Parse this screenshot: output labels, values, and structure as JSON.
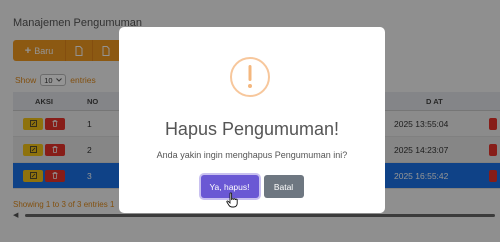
{
  "page": {
    "title": "Manajemen Pengumuman",
    "toolbar": {
      "new_label": "Baru"
    },
    "show": {
      "prefix": "Show",
      "value": "10",
      "suffix": "entries"
    },
    "table": {
      "columns": [
        "AKSI",
        "NO",
        "D AT"
      ],
      "rows": [
        {
          "no": "1",
          "updated": "2025 13:55:04"
        },
        {
          "no": "2",
          "updated": "2025 14:23:07"
        },
        {
          "no": "3",
          "updated": "2025 16:55:42"
        }
      ]
    },
    "footer": "Showing 1 to 3 of 3 entries 1"
  },
  "dialog": {
    "icon": "exclamation",
    "title": "Hapus Pengumuman!",
    "message": "Anda yakin ingin menghapus Pengumuman ini?",
    "confirm_label": "Ya, hapus!",
    "cancel_label": "Batal"
  },
  "colors": {
    "accent": "#f29a1f",
    "selected_row": "#1a73e8",
    "confirm": "#6a58d4",
    "cancel": "#6e7781",
    "warning": "#f7c79c"
  }
}
